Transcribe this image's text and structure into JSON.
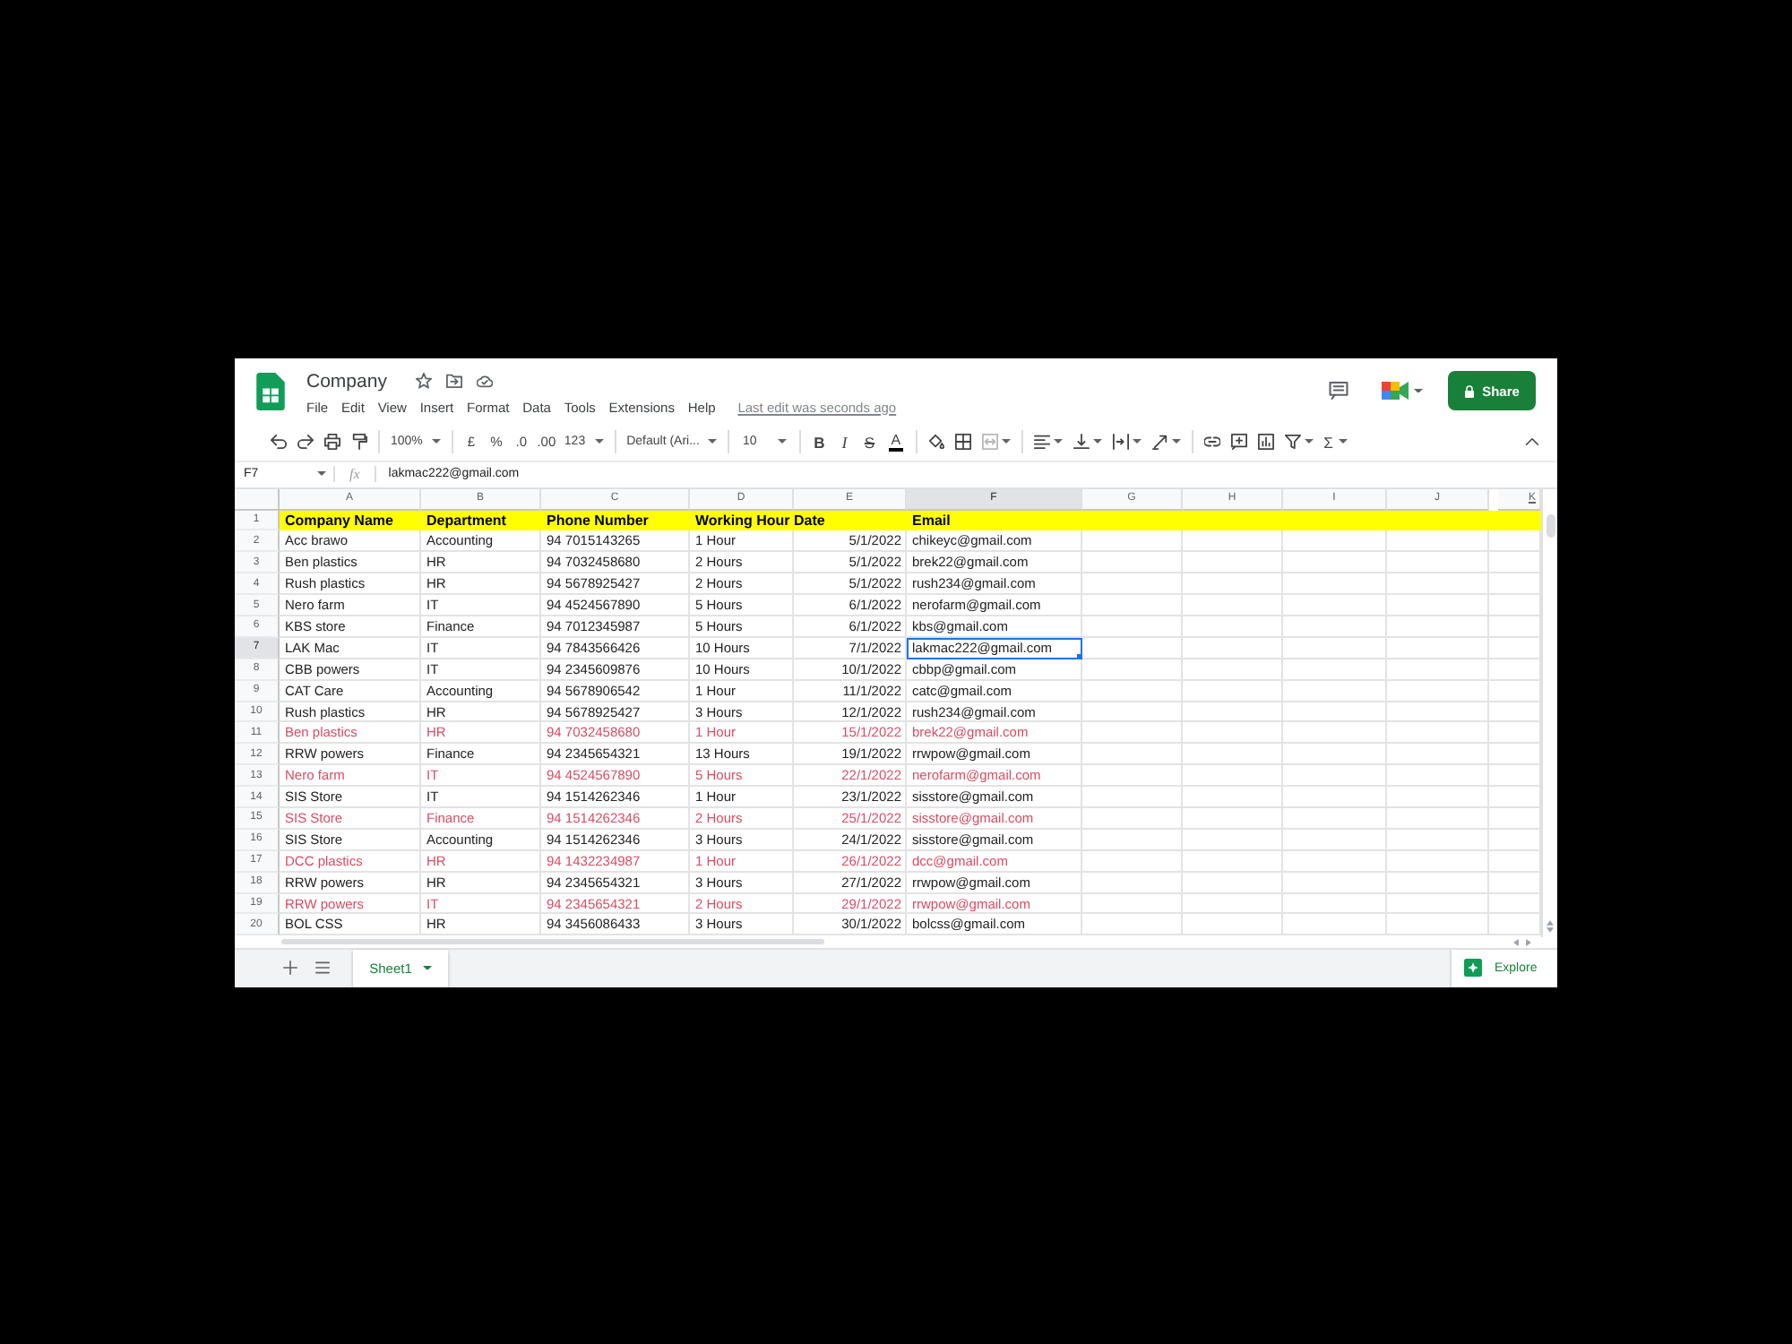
{
  "document": {
    "title": "Company",
    "menu": [
      "File",
      "Edit",
      "View",
      "Insert",
      "Format",
      "Data",
      "Tools",
      "Extensions",
      "Help"
    ],
    "last_edit": "Last edit was seconds ago",
    "share_label": "Share"
  },
  "toolbar": {
    "zoom": "100%",
    "currency": "£",
    "percent": "%",
    "decimal_decrease": ".0",
    "decimal_increase": ".00",
    "number_format": "123",
    "font": "Default (Ari...",
    "font_size": "10",
    "bold": "B",
    "italic": "I",
    "strikethrough": "S",
    "text_color": "A",
    "functions": "Σ"
  },
  "formula_bar": {
    "cell_ref": "F7",
    "fx": "fx",
    "value": "lakmac222@gmail.com"
  },
  "sheet": {
    "columns": [
      {
        "letter": "A",
        "selected": false
      },
      {
        "letter": "B",
        "selected": false
      },
      {
        "letter": "C",
        "selected": false
      },
      {
        "letter": "D",
        "selected": false
      },
      {
        "letter": "E",
        "selected": false
      },
      {
        "letter": "F",
        "selected": true
      },
      {
        "letter": "G",
        "selected": false
      },
      {
        "letter": "H",
        "selected": false
      },
      {
        "letter": "I",
        "selected": false
      },
      {
        "letter": "J",
        "selected": false
      },
      {
        "letter": "K",
        "selected": false
      }
    ],
    "header_row": {
      "number": "1",
      "company_name": "Company Name",
      "department": "Department",
      "phone_number": "Phone Number",
      "working_hour_date": "Working Hour Date",
      "email": "Email"
    },
    "rows": [
      {
        "number": "2",
        "color": "#222222",
        "selected": false,
        "company_name": "Acc brawo",
        "department": "Accounting",
        "phone_number": "94 7015143265",
        "working_hours": "1 Hour",
        "date": "5/1/2022",
        "email": "chikeyc@gmail.com"
      },
      {
        "number": "3",
        "color": "#222222",
        "selected": false,
        "company_name": "Ben plastics",
        "department": "HR",
        "phone_number": "94 7032458680",
        "working_hours": "2 Hours",
        "date": "5/1/2022",
        "email": "brek22@gmail.com"
      },
      {
        "number": "4",
        "color": "#222222",
        "selected": false,
        "company_name": "Rush plastics",
        "department": "HR",
        "phone_number": "94 5678925427",
        "working_hours": "2 Hours",
        "date": "5/1/2022",
        "email": "rush234@gmail.com"
      },
      {
        "number": "5",
        "color": "#222222",
        "selected": false,
        "company_name": "Nero farm",
        "department": "IT",
        "phone_number": "94 4524567890",
        "working_hours": "5 Hours",
        "date": "6/1/2022",
        "email": "nerofarm@gmail.com"
      },
      {
        "number": "6",
        "color": "#222222",
        "selected": false,
        "company_name": "KBS store",
        "department": "Finance",
        "phone_number": "94 7012345987",
        "working_hours": "5 Hours",
        "date": "6/1/2022",
        "email": "kbs@gmail.com"
      },
      {
        "number": "7",
        "color": "#222222",
        "selected": true,
        "company_name": "LAK Mac",
        "department": "IT",
        "phone_number": "94 7843566426",
        "working_hours": "10 Hours",
        "date": "7/1/2022",
        "email": "lakmac222@gmail.com"
      },
      {
        "number": "8",
        "color": "#222222",
        "selected": false,
        "company_name": "CBB powers",
        "department": "IT",
        "phone_number": "94 2345609876",
        "working_hours": "10 Hours",
        "date": "10/1/2022",
        "email": "cbbp@gmail.com"
      },
      {
        "number": "9",
        "color": "#222222",
        "selected": false,
        "company_name": "CAT Care",
        "department": "Accounting",
        "phone_number": "94 5678906542",
        "working_hours": "1 Hour",
        "date": "11/1/2022",
        "email": "catc@gmail.com"
      },
      {
        "number": "10",
        "color": "#222222",
        "selected": false,
        "company_name": "Rush plastics",
        "department": "HR",
        "phone_number": "94 5678925427",
        "working_hours": "3 Hours",
        "date": "12/1/2022",
        "email": "rush234@gmail.com"
      },
      {
        "number": "11",
        "color": "#d94c63",
        "selected": false,
        "company_name": "Ben plastics",
        "department": "HR",
        "phone_number": "94 7032458680",
        "working_hours": "1 Hour",
        "date": "15/1/2022",
        "email": "brek22@gmail.com"
      },
      {
        "number": "12",
        "color": "#222222",
        "selected": false,
        "company_name": "RRW powers",
        "department": "Finance",
        "phone_number": "94 2345654321",
        "working_hours": "13 Hours",
        "date": "19/1/2022",
        "email": "rrwpow@gmail.com"
      },
      {
        "number": "13",
        "color": "#d94c63",
        "selected": false,
        "company_name": "Nero farm",
        "department": "IT",
        "phone_number": "94 4524567890",
        "working_hours": "5 Hours",
        "date": "22/1/2022",
        "email": "nerofarm@gmail.com"
      },
      {
        "number": "14",
        "color": "#222222",
        "selected": false,
        "company_name": "SIS Store",
        "department": "IT",
        "phone_number": "94 1514262346",
        "working_hours": "1 Hour",
        "date": "23/1/2022",
        "email": "sisstore@gmail.com"
      },
      {
        "number": "15",
        "color": "#d94c63",
        "selected": false,
        "company_name": "SIS Store",
        "department": "Finance",
        "phone_number": "94 1514262346",
        "working_hours": "2 Hours",
        "date": "25/1/2022",
        "email": "sisstore@gmail.com"
      },
      {
        "number": "16",
        "color": "#222222",
        "selected": false,
        "company_name": "SIS Store",
        "department": "Accounting",
        "phone_number": "94 1514262346",
        "working_hours": "3 Hours",
        "date": "24/1/2022",
        "email": "sisstore@gmail.com"
      },
      {
        "number": "17",
        "color": "#d94c63",
        "selected": false,
        "company_name": "DCC plastics",
        "department": "HR",
        "phone_number": "94 1432234987",
        "working_hours": "1 Hour",
        "date": "26/1/2022",
        "email": "dcc@gmail.com"
      },
      {
        "number": "18",
        "color": "#222222",
        "selected": false,
        "company_name": "RRW powers",
        "department": "HR",
        "phone_number": "94 2345654321",
        "working_hours": "3 Hours",
        "date": "27/1/2022",
        "email": "rrwpow@gmail.com"
      },
      {
        "number": "19",
        "color": "#d94c63",
        "selected": false,
        "company_name": "RRW powers",
        "department": "IT",
        "phone_number": "94 2345654321",
        "working_hours": "2 Hours",
        "date": "29/1/2022",
        "email": "rrwpow@gmail.com"
      },
      {
        "number": "20",
        "color": "#222222",
        "selected": false,
        "company_name": "BOL CSS",
        "department": "HR",
        "phone_number": "94 3456086433",
        "working_hours": "3 Hours",
        "date": "30/1/2022",
        "email": "bolcss@gmail.com"
      }
    ]
  },
  "sheet_tabs": [
    {
      "label": "Sheet1",
      "selected": true
    }
  ],
  "explore_label": "Explore"
}
